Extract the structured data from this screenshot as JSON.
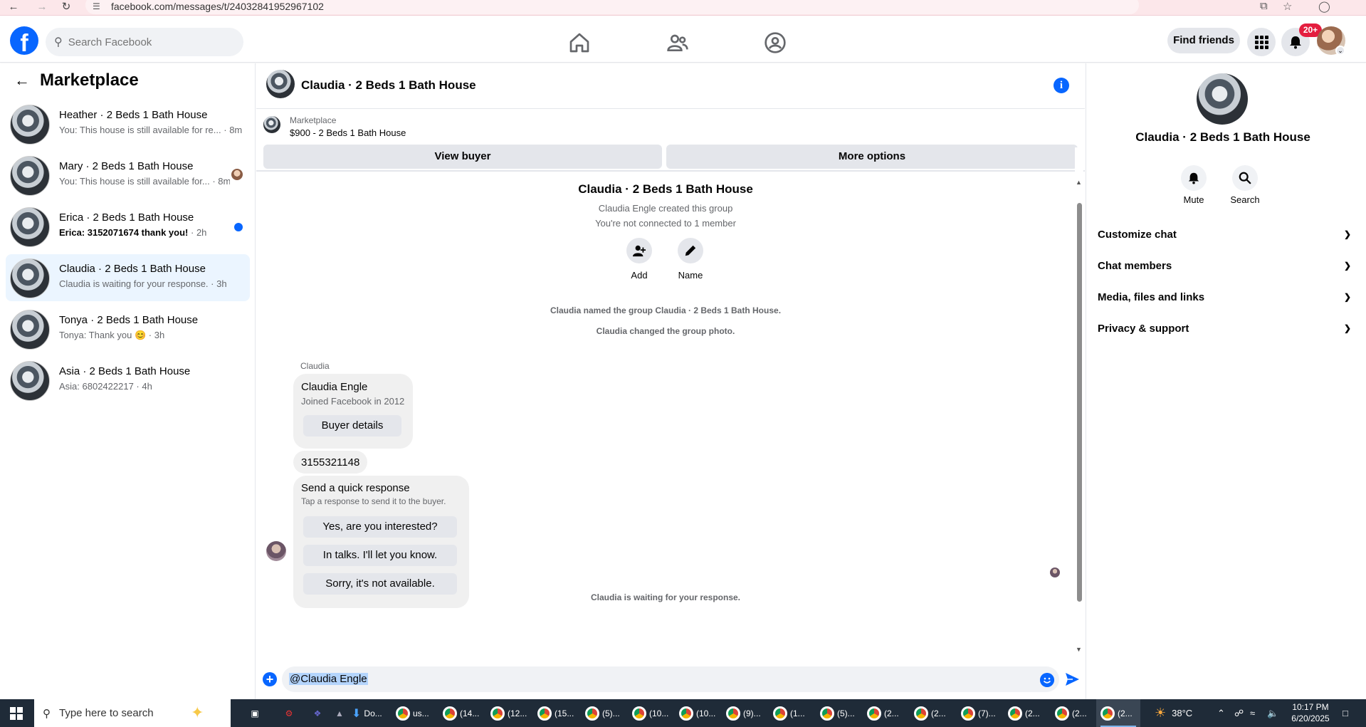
{
  "browser": {
    "url": "facebook.com/messages/t/24032841952967102"
  },
  "header": {
    "logo": "f",
    "search_placeholder": "Search Facebook",
    "find_friends": "Find friends",
    "notification_badge": "20+"
  },
  "sidebar": {
    "title": "Marketplace",
    "conversations": [
      {
        "title": "Heather · 2 Beds 1 Bath House",
        "preview": "You: This house is still available for re...",
        "time": "8m",
        "unread": false
      },
      {
        "title": "Mary · 2 Beds 1 Bath House",
        "preview": "You: This house is still available for...",
        "time": "8m",
        "unread": false
      },
      {
        "title": "Erica · 2 Beds 1 Bath House",
        "preview": "Erica: 3152071674 thank you!",
        "time": "2h",
        "unread": true
      },
      {
        "title": "Claudia · 2 Beds 1 Bath House",
        "preview": "Claudia is waiting for your response.",
        "time": "3h",
        "unread": false
      },
      {
        "title": "Tonya · 2 Beds 1 Bath House",
        "preview": "Tonya: Thank you 😊",
        "time": "3h",
        "unread": false
      },
      {
        "title": "Asia · 2 Beds 1 Bath House",
        "preview": "Asia: 6802422217",
        "time": "4h",
        "unread": false
      }
    ]
  },
  "chat": {
    "title": "Claudia · 2 Beds 1 Bath House",
    "listing_source": "Marketplace",
    "listing_title": "$900 - 2 Beds 1 Bath House",
    "view_buyer": "View buyer",
    "more_options": "More options",
    "group_title": "Claudia · 2 Beds 1 Bath House",
    "group_created": "Claudia Engle created this group",
    "group_connection": "You're not connected to 1 member",
    "add_label": "Add",
    "name_label": "Name",
    "sys_named": "Claudia named the group Claudia · 2 Beds 1 Bath House.",
    "sys_photo": "Claudia changed the group photo.",
    "sender": "Claudia",
    "card_name": "Claudia Engle",
    "card_joined": "Joined Facebook in 2012",
    "buyer_details": "Buyer details",
    "phone_message": "3155321148",
    "quick_title": "Send a quick response",
    "quick_sub": "Tap a response to send it to the buyer.",
    "quick_responses": [
      "Yes, are you interested?",
      "In talks. I'll let you know.",
      "Sorry, it's not available."
    ],
    "waiting": "Claudia is waiting for your response.",
    "composer_text": "@Claudia Engle"
  },
  "details": {
    "name": "Claudia · 2 Beds 1 Bath House",
    "mute": "Mute",
    "search": "Search",
    "sections": [
      "Customize chat",
      "Chat members",
      "Media, files and links",
      "Privacy & support"
    ]
  },
  "taskbar": {
    "search_placeholder": "Type here to search",
    "items": [
      "Do...",
      "us...",
      "(14...",
      "(12...",
      "(15...",
      "(5)...",
      "(10...",
      "(10...",
      "(9)...",
      "(1...",
      "(5)...",
      "(2...",
      "(2...",
      "(7)...",
      "(2...",
      "(2...",
      "(2..."
    ],
    "temperature": "38°C",
    "time": "10:17 PM",
    "date": "6/20/2025"
  },
  "colors": {
    "brand": "#0866ff",
    "active_conversation": "#ebf5ff",
    "badge": "#e41e3f"
  }
}
